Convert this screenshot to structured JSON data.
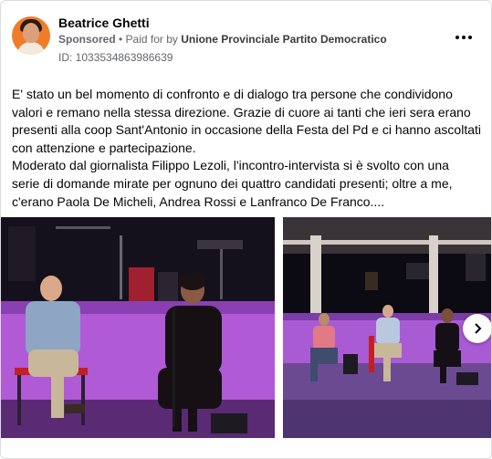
{
  "post": {
    "author": "Beatrice Ghetti",
    "sponsored": "Sponsored",
    "paid_prefix": "• Paid for by",
    "sponsor": "Unione Provinciale Partito Democratico",
    "ad_id": "ID: 1033534863986639",
    "body_lines": [
      "E' stato un bel momento di confronto e di dialogo tra persone che condividono",
      "valori e remano nella stessa direzione. Grazie di cuore ai tanti che ieri sera erano",
      "presenti alla coop Sant'Antonio in occasione della Festa del Pd e ci hanno ascoltati",
      "con attenzione e partecipazione.",
      "Moderato dal giornalista Filippo Lezoli, l'incontro-intervista si è svolto con una",
      "serie di domande mirate per ognuno dei quattro candidati presenti; oltre a me,",
      "c'erano Paola De Micheli, Andrea Rossi e Lanfranco De Franco...."
    ]
  },
  "icons": {
    "more": "more-options-icon",
    "next": "chevron-right-icon"
  },
  "colors": {
    "avatar_bg": "#f07c2a",
    "meta_text": "#65676b",
    "stage_light": "#b05ad6"
  }
}
